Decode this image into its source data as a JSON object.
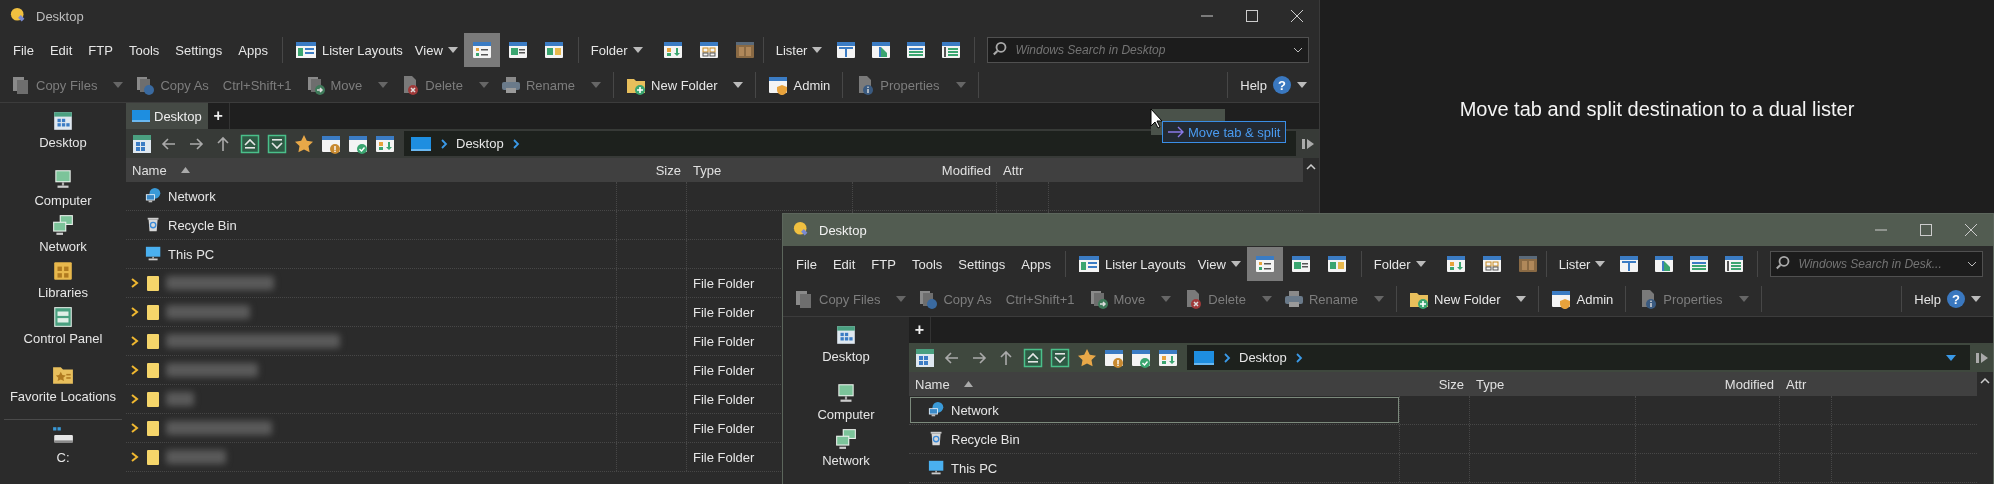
{
  "caption": "Move tab and split destination to a dual lister",
  "windows": [
    {
      "title": "Desktop",
      "active": false,
      "menus": [
        "File",
        "Edit",
        "FTP",
        "Tools",
        "Settings",
        "Apps"
      ],
      "layouts": "Lister Layouts",
      "view": {
        "label": "View",
        "modes": [
          {
            "selected": true
          },
          {
            "selected": false
          },
          {
            "selected": false
          }
        ]
      },
      "folder": "Folder",
      "lister": "Lister",
      "search": {
        "placeholder": "Windows Search in Desktop"
      },
      "actions": [
        {
          "kind": "copy",
          "label": "Copy Files",
          "disabled": true,
          "dropdown": true
        },
        {
          "kind": "copyas",
          "label": "Copy As",
          "shortcut": "Ctrl+Shift+1",
          "disabled": true,
          "dropdown": false
        },
        {
          "kind": "move",
          "label": "Move",
          "disabled": true,
          "dropdown": true
        },
        {
          "kind": "delete",
          "label": "Delete",
          "disabled": true,
          "dropdown": true
        },
        {
          "kind": "rename",
          "label": "Rename",
          "disabled": true,
          "dropdown": true
        },
        {
          "kind": "newfolder",
          "label": "New Folder",
          "disabled": false,
          "dropdown": true
        },
        {
          "kind": "admin",
          "label": "Admin",
          "disabled": false,
          "dropdown": false
        },
        {
          "kind": "properties",
          "label": "Properties",
          "disabled": true,
          "dropdown": true
        }
      ],
      "help": {
        "label": "Help",
        "icon": "?"
      },
      "sidebar": [
        [
          {
            "kind": "desktop",
            "label": "Desktop"
          }
        ],
        [
          {
            "kind": "computer",
            "label": "Computer"
          },
          {
            "kind": "network",
            "label": "Network"
          },
          {
            "kind": "libraries",
            "label": "Libraries"
          },
          {
            "kind": "control",
            "label": "Control Panel"
          }
        ],
        [
          {
            "kind": "favorites",
            "label": "Favorite Locations"
          }
        ],
        [
          {
            "kind": "drive",
            "label": "C:"
          }
        ]
      ],
      "tabs": [
        {
          "label": "Desktop",
          "selected": true
        }
      ],
      "new_tab": "+",
      "breadcrumb": "Desktop",
      "columns": [
        {
          "label": "Name",
          "sorted": true
        },
        {
          "label": "Size",
          "sorted": false
        },
        {
          "label": "Type",
          "sorted": false
        },
        {
          "label": "Modified",
          "sorted": false
        },
        {
          "label": "Attr",
          "sorted": false
        }
      ],
      "rows": [
        {
          "kind": "network",
          "name": "Network",
          "focused": false
        },
        {
          "kind": "recycle",
          "name": "Recycle Bin",
          "focused": false
        },
        {
          "kind": "pc",
          "name": "This PC",
          "focused": false
        },
        {
          "kind": "folder",
          "type": "File Folder",
          "focused": false
        },
        {
          "kind": "folder",
          "type": "File Folder",
          "focused": false
        },
        {
          "kind": "folder",
          "type": "File Folder",
          "focused": false
        },
        {
          "kind": "folder",
          "type": "File Folder",
          "focused": false
        },
        {
          "kind": "folder",
          "type": "File Folder",
          "focused": false
        },
        {
          "kind": "folder",
          "type": "File Folder",
          "focused": false
        },
        {
          "kind": "folder",
          "type": "File Folder",
          "focused": false
        }
      ],
      "drag": {
        "tooltip": "Move tab & split"
      }
    },
    {
      "title": "Desktop",
      "active": true,
      "menus": [
        "File",
        "Edit",
        "FTP",
        "Tools",
        "Settings",
        "Apps"
      ],
      "layouts": "Lister Layouts",
      "view": {
        "label": "View",
        "modes": [
          {
            "selected": true
          },
          {
            "selected": false
          },
          {
            "selected": false
          }
        ]
      },
      "folder": "Folder",
      "lister": "Lister",
      "search": {
        "placeholder": "Windows Search in Desk..."
      },
      "actions": [
        {
          "kind": "copy",
          "label": "Copy Files",
          "disabled": true,
          "dropdown": true
        },
        {
          "kind": "copyas",
          "label": "Copy As",
          "shortcut": "Ctrl+Shift+1",
          "disabled": true,
          "dropdown": false
        },
        {
          "kind": "move",
          "label": "Move",
          "disabled": true,
          "dropdown": true
        },
        {
          "kind": "delete",
          "label": "Delete",
          "disabled": true,
          "dropdown": true
        },
        {
          "kind": "rename",
          "label": "Rename",
          "disabled": true,
          "dropdown": true
        },
        {
          "kind": "newfolder",
          "label": "New Folder",
          "disabled": false,
          "dropdown": true
        },
        {
          "kind": "admin",
          "label": "Admin",
          "disabled": false,
          "dropdown": false
        },
        {
          "kind": "properties",
          "label": "Properties",
          "disabled": true,
          "dropdown": true
        }
      ],
      "help": {
        "label": "Help",
        "icon": "?"
      },
      "sidebar": [
        [
          {
            "kind": "desktop",
            "label": "Desktop"
          }
        ],
        [
          {
            "kind": "computer",
            "label": "Computer"
          },
          {
            "kind": "network",
            "label": "Network"
          }
        ]
      ],
      "new_tab": "+",
      "breadcrumb": "Desktop",
      "columns": [
        {
          "label": "Name",
          "sorted": true
        },
        {
          "label": "Size",
          "sorted": false
        },
        {
          "label": "Type",
          "sorted": false
        },
        {
          "label": "Modified",
          "sorted": false
        },
        {
          "label": "Attr",
          "sorted": false
        }
      ],
      "rows": [
        {
          "kind": "network",
          "name": "Network",
          "focused": true
        },
        {
          "kind": "recycle",
          "name": "Recycle Bin",
          "focused": false
        },
        {
          "kind": "pc",
          "name": "This PC",
          "focused": false
        }
      ]
    }
  ]
}
